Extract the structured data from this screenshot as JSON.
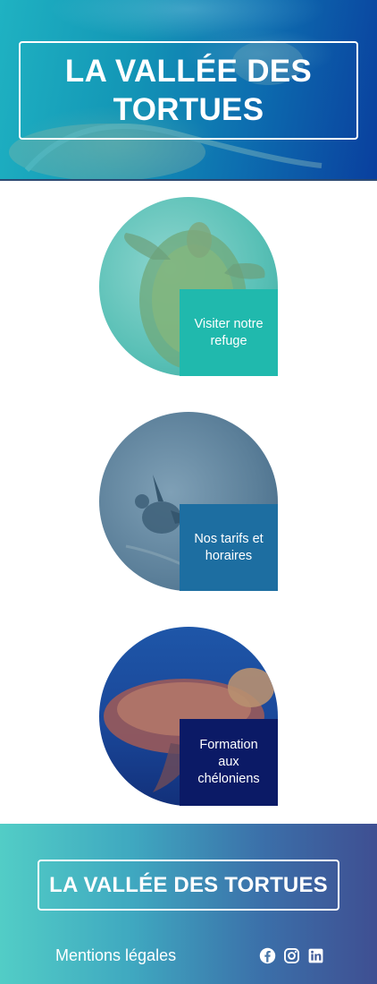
{
  "header": {
    "title": "LA VALLÉE DES TORTUES"
  },
  "cards": [
    {
      "label": "Visiter notre refuge",
      "color": "#20b9ad"
    },
    {
      "label": "Nos tarifs et horaires",
      "color": "#1d6ea1"
    },
    {
      "label": "Formation aux chéloniens",
      "color": "#0b1a66"
    }
  ],
  "footer": {
    "title": "LA VALLÉE DES TORTUES",
    "legal_link": "Mentions légales",
    "social_icons": [
      "facebook-icon",
      "instagram-icon",
      "linkedin-icon"
    ]
  }
}
